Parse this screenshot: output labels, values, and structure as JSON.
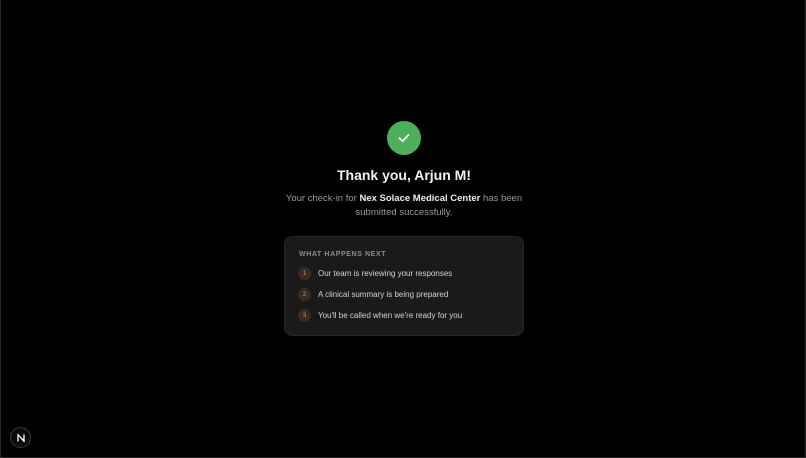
{
  "confirmation": {
    "icon": "check-icon",
    "accent_color": "#4caf5a",
    "title": "Thank you, Arjun M!",
    "subtitle_before": "Your check-in for ",
    "facility_name": "Nex Solace Medical Center",
    "subtitle_after": " has been submitted successfully."
  },
  "next_steps": {
    "heading": "WHAT HAPPENS NEXT",
    "steps": [
      {
        "number": "1",
        "text": "Our team is reviewing your responses"
      },
      {
        "number": "2",
        "text": "A clinical summary is being prepared"
      },
      {
        "number": "3",
        "text": "You'll be called when we're ready for you"
      }
    ]
  },
  "corner_badge": {
    "icon": "n-logo-icon"
  }
}
